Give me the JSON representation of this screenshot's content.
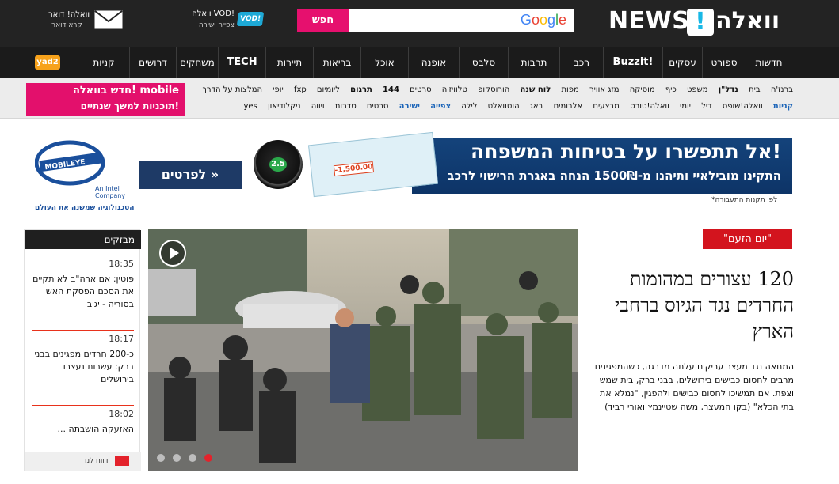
{
  "header": {
    "logo_brand": "NEWS",
    "logo_mark": "!",
    "logo_hebrew": "וואלה",
    "search_button": "חפש",
    "search_engine": "Google",
    "search_value": "",
    "vod_line1": "וואלה VOD!",
    "vod_line2": "צפייה ישירה",
    "vod_badge": "VOD!",
    "mail_line1": "וואלה! דואר",
    "mail_line2": "קרא דואר"
  },
  "nav": {
    "items": [
      "חדשות",
      "ספורט",
      "עסקים",
      "Buzzit!",
      "רכב",
      "תרבות",
      "סלבס",
      "אופנה",
      "אוכל",
      "בריאות",
      "תיירות",
      "TECH",
      "משחקים",
      "דרושים",
      "קניות"
    ],
    "yad2": "yad2"
  },
  "links": {
    "row1": [
      "ברנז'ה",
      "בית",
      "נדל\"ן",
      "משפט",
      "כיף",
      "מוסיקה",
      "מזג אוויר",
      "מפות",
      "לוח שנה",
      "הורוסקופ",
      "טלוויזיה",
      "סרטים",
      "144",
      "תרגום",
      "ליומיום",
      "fxp",
      "יופי",
      "המלצות על הדרך"
    ],
    "row2": [
      "קניות",
      "וואלה!שופס",
      "דיל",
      "יומי",
      "וואלה!טורס",
      "מבצעים",
      "אלבומים",
      "באג",
      "הוטוואלט",
      "לילה",
      "צפייה",
      "ישירה",
      "סרטים",
      "סדרות",
      "ויווה",
      "ניקלודיאון",
      "yes"
    ],
    "mobile_ad_line1": "חדש בוואלה! mobile",
    "mobile_ad_line2": "תוכניות למשך שנתיים!"
  },
  "ad": {
    "brand": "MOBILEYE",
    "brand_intel": "An Intel Company",
    "brand_tagline": "הטכנולוגיה שמשנה את העולם",
    "cta": "לפרטים »",
    "headline": "אל תתפשרו על בטיחות המשפחה!",
    "subline": "התקינו מובילאיי ותיהנו מ-1500₪ הנחה באגרת הרישוי לרכב",
    "ticket_price": "-1,500.00",
    "device_reading": "2.5",
    "fineprint": "*לפי תקנות התעבורה"
  },
  "sidebar": {
    "title": "מבזקים",
    "items": [
      {
        "time": "18:35",
        "text": "פוטין: אם ארה\"ב לא תקיים את הסכם הפסקת האש בסוריה - יגיב"
      },
      {
        "time": "18:17",
        "text": "כ-200 חרדים מפגינים בבני ברק: עשרות נעצרו בירושלים"
      },
      {
        "time": "18:02",
        "text": "האזעקה הושבתה ..."
      }
    ],
    "footer_link": "דווח לנו"
  },
  "main": {
    "kicker": "\"יום הזעם\"",
    "headline": "120 עצורים במהומות החרדים נגד הגיוס ברחבי הארץ",
    "lead": "המחאה נגד מעצר עריקים עלתה מדרגה, כשהמפגינים מרבים לחסום כבישים בירושלים, בבני ברק, בית שמש וצפת. אם תמשיכו לחסום כבישים ולהפגין, \"נמלא את בתי הכלא\" (בקו המעצר, משה שטיינמץ ואורי רביד)",
    "slider_count": 4,
    "slider_active": 4
  },
  "colors": {
    "accent_pink": "#e6106e",
    "accent_red": "#d3141e",
    "brand_blue": "#18b8e6",
    "topbar": "#232323"
  }
}
